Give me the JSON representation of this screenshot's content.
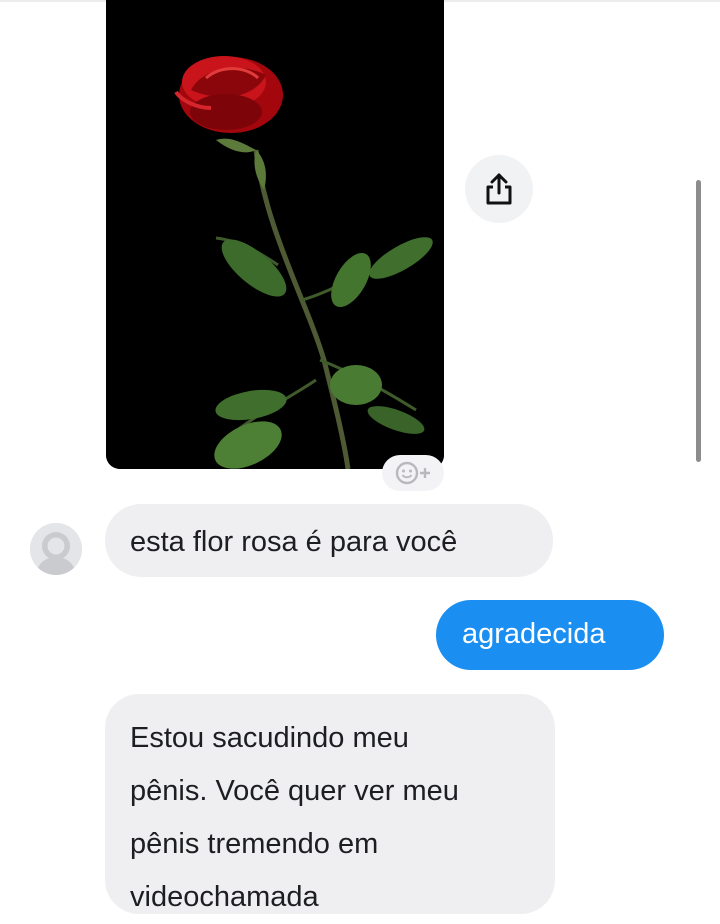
{
  "conversation": {
    "shared_image": {
      "alt": "red rose on black background"
    },
    "share_button_icon": "share-upload-icon",
    "reaction_button_icon": "add-reaction-icon",
    "messages": [
      {
        "sender": "them",
        "text": "esta flor rosa é para você"
      },
      {
        "sender": "me",
        "text": "agradecida"
      },
      {
        "sender": "them",
        "lines": [
          "Estou sacudindo meu",
          "pênis. Você quer ver meu",
          "pênis tremendo em",
          "videochamada"
        ]
      }
    ]
  },
  "colors": {
    "incoming_bubble": "#efeff1",
    "outgoing_bubble": "#1b8ef2",
    "outgoing_text": "#ffffff",
    "incoming_text": "#1c1e21"
  }
}
